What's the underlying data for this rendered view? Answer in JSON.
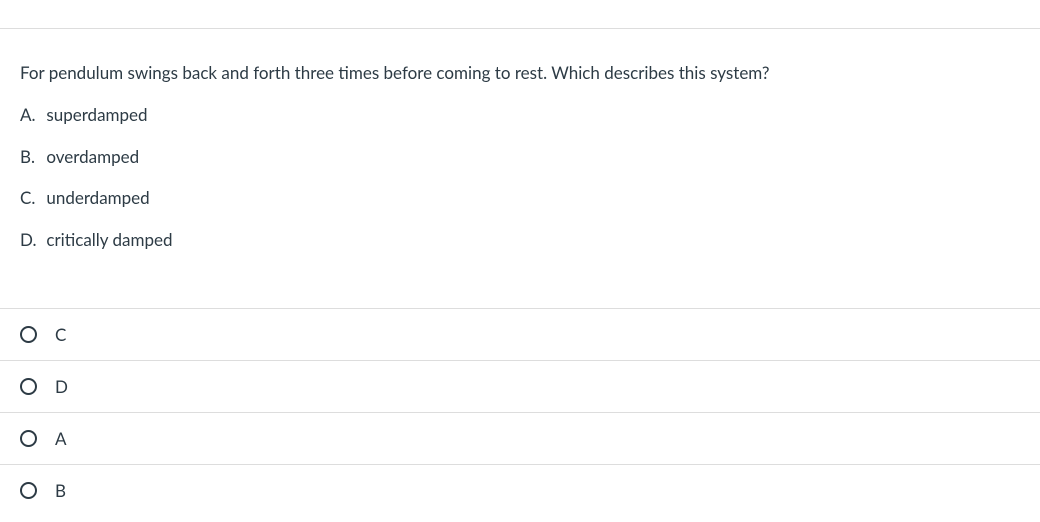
{
  "question": {
    "text": "For pendulum swings back and forth three times before coming to rest. Which describes this system?",
    "definitions": [
      {
        "letter": "A.",
        "text": "superdamped"
      },
      {
        "letter": "B.",
        "text": "overdamped"
      },
      {
        "letter": "C.",
        "text": "underdamped"
      },
      {
        "letter": "D.",
        "text": "critically damped"
      }
    ],
    "answers": [
      {
        "label": "C"
      },
      {
        "label": "D"
      },
      {
        "label": "A"
      },
      {
        "label": "B"
      }
    ]
  }
}
